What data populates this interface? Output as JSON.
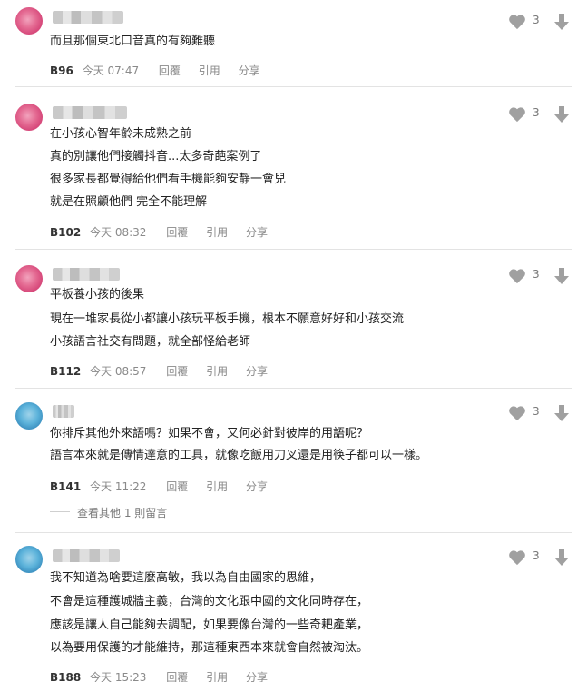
{
  "comments": [
    {
      "lines": [
        "而且那個東北口音真的有夠難聽"
      ],
      "floor": "B96",
      "time": "今天 07:47",
      "reply": "回覆",
      "quote": "引用",
      "share": "分享",
      "likes": "3"
    },
    {
      "lines": [
        "在小孩心智年齡未成熟之前",
        "真的別讓他們接觸抖音...太多奇葩案例了",
        "很多家長都覺得給他們看手機能夠安靜一會兒",
        "就是在照顧他們 完全不能理解"
      ],
      "floor": "B102",
      "time": "今天 08:32",
      "reply": "回覆",
      "quote": "引用",
      "share": "分享",
      "likes": "3"
    },
    {
      "lines": [
        "平板養小孩的後果",
        "現在一堆家長從小都讓小孩玩平板手機，根本不願意好好和小孩交流",
        "小孩語言社交有問題，就全部怪給老師"
      ],
      "floor": "B112",
      "time": "今天 08:57",
      "reply": "回覆",
      "quote": "引用",
      "share": "分享",
      "likes": "3"
    },
    {
      "lines": [
        "你排斥其他外來語嗎？如果不會，又何必針對彼岸的用語呢？",
        "語言本來就是傳情達意的工具，就像吃飯用刀叉還是用筷子都可以一樣。"
      ],
      "floor": "B141",
      "time": "今天 11:22",
      "reply": "回覆",
      "quote": "引用",
      "share": "分享",
      "likes": "3",
      "more": "查看其他 1 則留言"
    },
    {
      "lines": [
        "我不知道為啥要這麼高敏，我以為自由國家的思維，",
        "不會是這種護城牆主義，台灣的文化跟中國的文化同時存在，",
        "應該是讓人自己能夠去調配，如果要像台灣的一些奇耙產業，",
        "以為要用保護的才能維持，那這種東西本來就會自然被淘汰。"
      ],
      "floor": "B188",
      "time": "今天 15:23",
      "reply": "回覆",
      "quote": "引用",
      "share": "分享",
      "likes": "3"
    }
  ],
  "colors": {
    "text": "#222222",
    "meta": "#8a8a8a",
    "icon": "#9e9e9e",
    "divider": "#e3e3e3"
  },
  "icons": {
    "like": "heart-icon",
    "dislike": "arrow-down-icon"
  }
}
